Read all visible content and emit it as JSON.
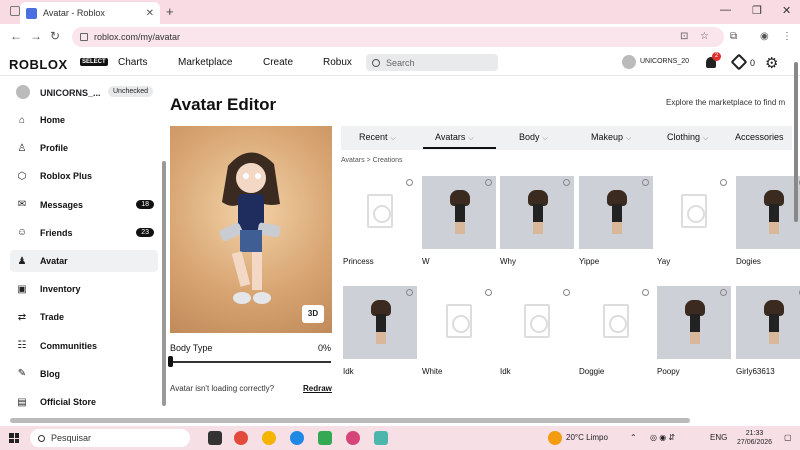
{
  "browser": {
    "tab_title": "Avatar - Roblox",
    "tab_close": "✕",
    "new_tab": "+",
    "win_min": "—",
    "win_max": "❐",
    "win_close": "✕",
    "back": "←",
    "forward": "→",
    "reload": "↻",
    "url": "roblox.com/my/avatar"
  },
  "nav": {
    "logo": "ROBLOX",
    "select_badge": "SELECT",
    "links": [
      "Charts",
      "Marketplace",
      "Create",
      "Robux"
    ],
    "search_placeholder": "Search",
    "username": "UNICORNS_20",
    "notifications": "2",
    "robux": "0"
  },
  "sidebar": {
    "username": "UNICORNS_...",
    "badge": "Unchecked",
    "items": [
      {
        "label": "Home",
        "icon": "home-icon",
        "glyph": "⌂"
      },
      {
        "label": "Profile",
        "icon": "profile-icon",
        "glyph": "♙"
      },
      {
        "label": "Roblox Plus",
        "icon": "roblox-plus-icon",
        "glyph": "⬡"
      },
      {
        "label": "Messages",
        "icon": "messages-icon",
        "glyph": "✉",
        "count": "18"
      },
      {
        "label": "Friends",
        "icon": "friends-icon",
        "glyph": "☺",
        "count": "23"
      },
      {
        "label": "Avatar",
        "icon": "avatar-icon",
        "glyph": "♟"
      },
      {
        "label": "Inventory",
        "icon": "inventory-icon",
        "glyph": "▣"
      },
      {
        "label": "Trade",
        "icon": "trade-icon",
        "glyph": "⇄"
      },
      {
        "label": "Communities",
        "icon": "communities-icon",
        "glyph": "☷"
      },
      {
        "label": "Blog",
        "icon": "blog-icon",
        "glyph": "✎"
      },
      {
        "label": "Official Store",
        "icon": "store-icon",
        "glyph": "▤"
      }
    ]
  },
  "main": {
    "title": "Avatar Editor",
    "explore_text": "Explore the marketplace to find m",
    "btn3d": "3D",
    "body_type_label": "Body Type",
    "body_type_value": "0%",
    "body_type_level": 0,
    "loading_question": "Avatar isn't loading correctly?",
    "redraw": "Redraw",
    "tabs": [
      "Recent",
      "Avatars",
      "Body",
      "Makeup",
      "Clothing",
      "Accessories"
    ],
    "active_tab": "Avatars",
    "breadcrumb": "Avatars > Creations",
    "items": [
      {
        "name": "Princess",
        "has_image": false
      },
      {
        "name": "W",
        "has_image": true
      },
      {
        "name": "Why",
        "has_image": true
      },
      {
        "name": "Yippe",
        "has_image": true
      },
      {
        "name": "Yay",
        "has_image": false
      },
      {
        "name": "Dogies",
        "has_image": true
      },
      {
        "name": "Idk",
        "has_image": true
      },
      {
        "name": "White",
        "has_image": false
      },
      {
        "name": "Idk",
        "has_image": false
      },
      {
        "name": "Doggie",
        "has_image": false
      },
      {
        "name": "Poopy",
        "has_image": true
      },
      {
        "name": "Girly63613",
        "has_image": true
      }
    ]
  },
  "taskbar": {
    "search_placeholder": "Pesquisar",
    "weather": "20°C Limpo",
    "lang": "ENG",
    "time": "21:33",
    "date": "27/06/2026"
  }
}
